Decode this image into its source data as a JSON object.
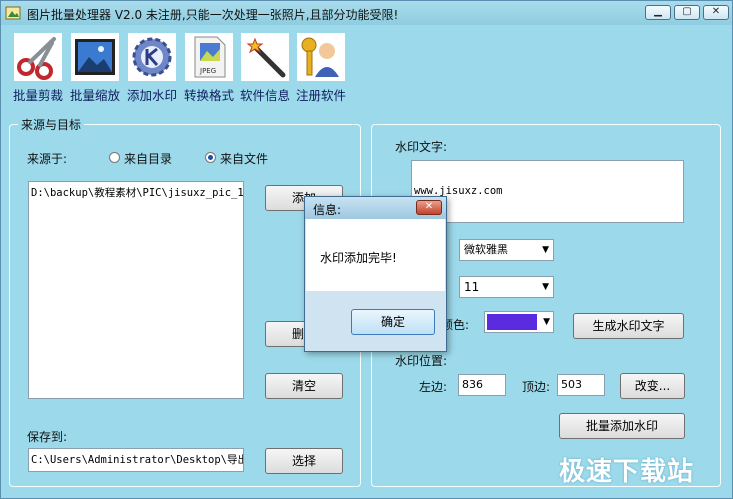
{
  "window": {
    "title": "图片批量处理器 V2.0  未注册,只能一次处理一张照片,且部分功能受限!"
  },
  "toolbar": [
    {
      "label": "批量剪裁",
      "icon": "scissors-icon"
    },
    {
      "label": "批量缩放",
      "icon": "picture-icon"
    },
    {
      "label": "添加水印",
      "icon": "gear-k-icon"
    },
    {
      "label": "转换格式",
      "icon": "jpeg-file-icon"
    },
    {
      "label": "软件信息",
      "icon": "magic-wand-icon"
    },
    {
      "label": "注册软件",
      "icon": "user-key-icon"
    }
  ],
  "source_group": {
    "title": "来源与目标",
    "source_label": "来源于:",
    "radio_dir": "来自目录",
    "radio_file": "来自文件",
    "selected": "来自文件",
    "file_list": [
      "D:\\backup\\教程素材\\PIC\\jisuxz_pic_1"
    ],
    "add_button": "添加",
    "delete_button": "删除",
    "clear_button": "清空",
    "save_label": "保存到:",
    "save_path": "C:\\Users\\Administrator\\Desktop\\导出",
    "choose_button": "选择"
  },
  "watermark_group": {
    "text_label": "水印文字:",
    "text_value": "www.jisuxz.com",
    "font_value": "微软雅黑",
    "size_value": "11",
    "color_label": "颜色:",
    "color": "#5b2be0",
    "generate_button": "生成水印文字",
    "position_label": "水印位置:",
    "left_label": "左边:",
    "left_value": "836",
    "top_label": "顶边:",
    "top_value": "503",
    "change_button": "改变...",
    "batch_button": "批量添加水印"
  },
  "dialog": {
    "title": "信息:",
    "message": "水印添加完毕!",
    "ok_button": "确定"
  },
  "brand_watermark": "极速下载站"
}
